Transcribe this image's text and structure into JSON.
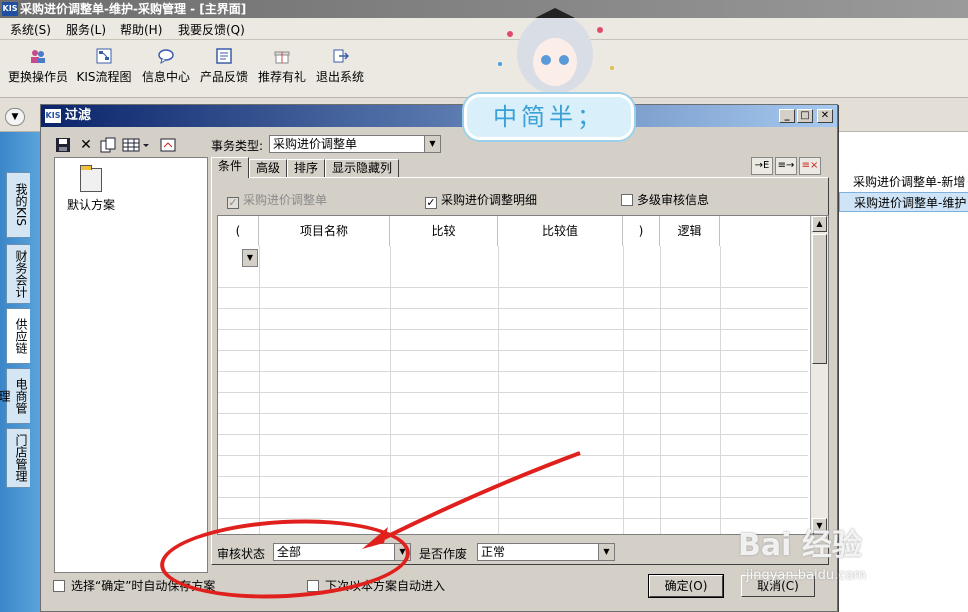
{
  "window": {
    "logo": "KIS",
    "title": "采购进价调整单-维护-采购管理 - [主界面]"
  },
  "menu": [
    "系统(S)",
    "服务(L)",
    "帮助(H)",
    "我要反馈(Q)"
  ],
  "toolbar": [
    {
      "label": "更换操作员",
      "icon": "users-icon"
    },
    {
      "label": "KIS流程图",
      "icon": "flowchart-icon"
    },
    {
      "label": "信息中心",
      "icon": "message-icon"
    },
    {
      "label": "产品反馈",
      "icon": "feedback-icon"
    },
    {
      "label": "推荐有礼",
      "icon": "gift-icon"
    },
    {
      "label": "退出系统",
      "icon": "exit-icon"
    }
  ],
  "side_tabs": [
    "我的KIS",
    "财务会计",
    "供应链",
    "电商管理",
    "门店管理"
  ],
  "right_list": [
    "采购进价调整单-新增",
    "采购进价调整单-维护"
  ],
  "dialog": {
    "logo": "KIS",
    "title": "过滤",
    "scheme": "默认方案",
    "biz_type_label": "事务类型:",
    "biz_type_value": "采购进价调整单",
    "tabs": [
      "条件",
      "高级",
      "排序",
      "显示隐藏列"
    ],
    "checks": [
      {
        "label": "采购进价调整单",
        "checked": true,
        "disabled": true
      },
      {
        "label": "采购进价调整明细",
        "checked": true,
        "disabled": false
      },
      {
        "label": "多级审核信息",
        "checked": false,
        "disabled": false
      }
    ],
    "grid_headers": [
      "(",
      "项目名称",
      "比较",
      "比较值",
      ")",
      "逻辑"
    ],
    "audit_label": "审核状态",
    "audit_value": "全部",
    "void_label": "是否作废",
    "void_value": "正常",
    "auto_save_label": "选择“确定”时自动保存方案",
    "auto_enter_label": "下次以本方案自动进入",
    "ok_label": "确定(O)",
    "cancel_label": "取消(C)"
  },
  "banner_text": "中简半；",
  "watermark": {
    "brand": "Bai 经验",
    "url": "jingyan.baidu.com"
  }
}
